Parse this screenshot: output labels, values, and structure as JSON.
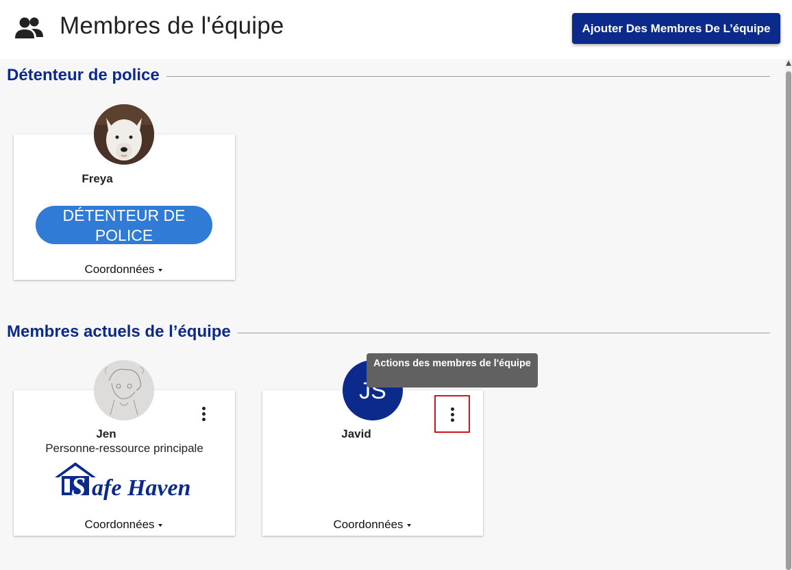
{
  "header": {
    "title": "Membres de l'équipe",
    "add_button_label": "Ajouter Des Membres De L’équipe",
    "icon": "team-icon"
  },
  "sections": {
    "policy_holder": {
      "title": "Détenteur de police",
      "card": {
        "name": "Freya",
        "badge": "DÉTENTEUR DE POLICE",
        "contact_label": "Coordonnées",
        "avatar": "dog-photo"
      }
    },
    "current_members": {
      "title": "Membres actuels de l’équipe",
      "cards": [
        {
          "name": "Jen",
          "role": "Personne-ressource principale",
          "organization_logo": "Safe Haven",
          "contact_label": "Coordonnées",
          "avatar": "sketch-portrait"
        },
        {
          "name": "Javid",
          "initials": "JS",
          "contact_label": "Coordonnées"
        }
      ]
    }
  },
  "tooltip": {
    "text": "Actions des membres de l'équipe"
  },
  "colors": {
    "brand_navy": "#0b2a8c",
    "badge_blue": "#2f7bd6",
    "highlight_red": "#d0141c",
    "tooltip_gray": "#616161"
  }
}
